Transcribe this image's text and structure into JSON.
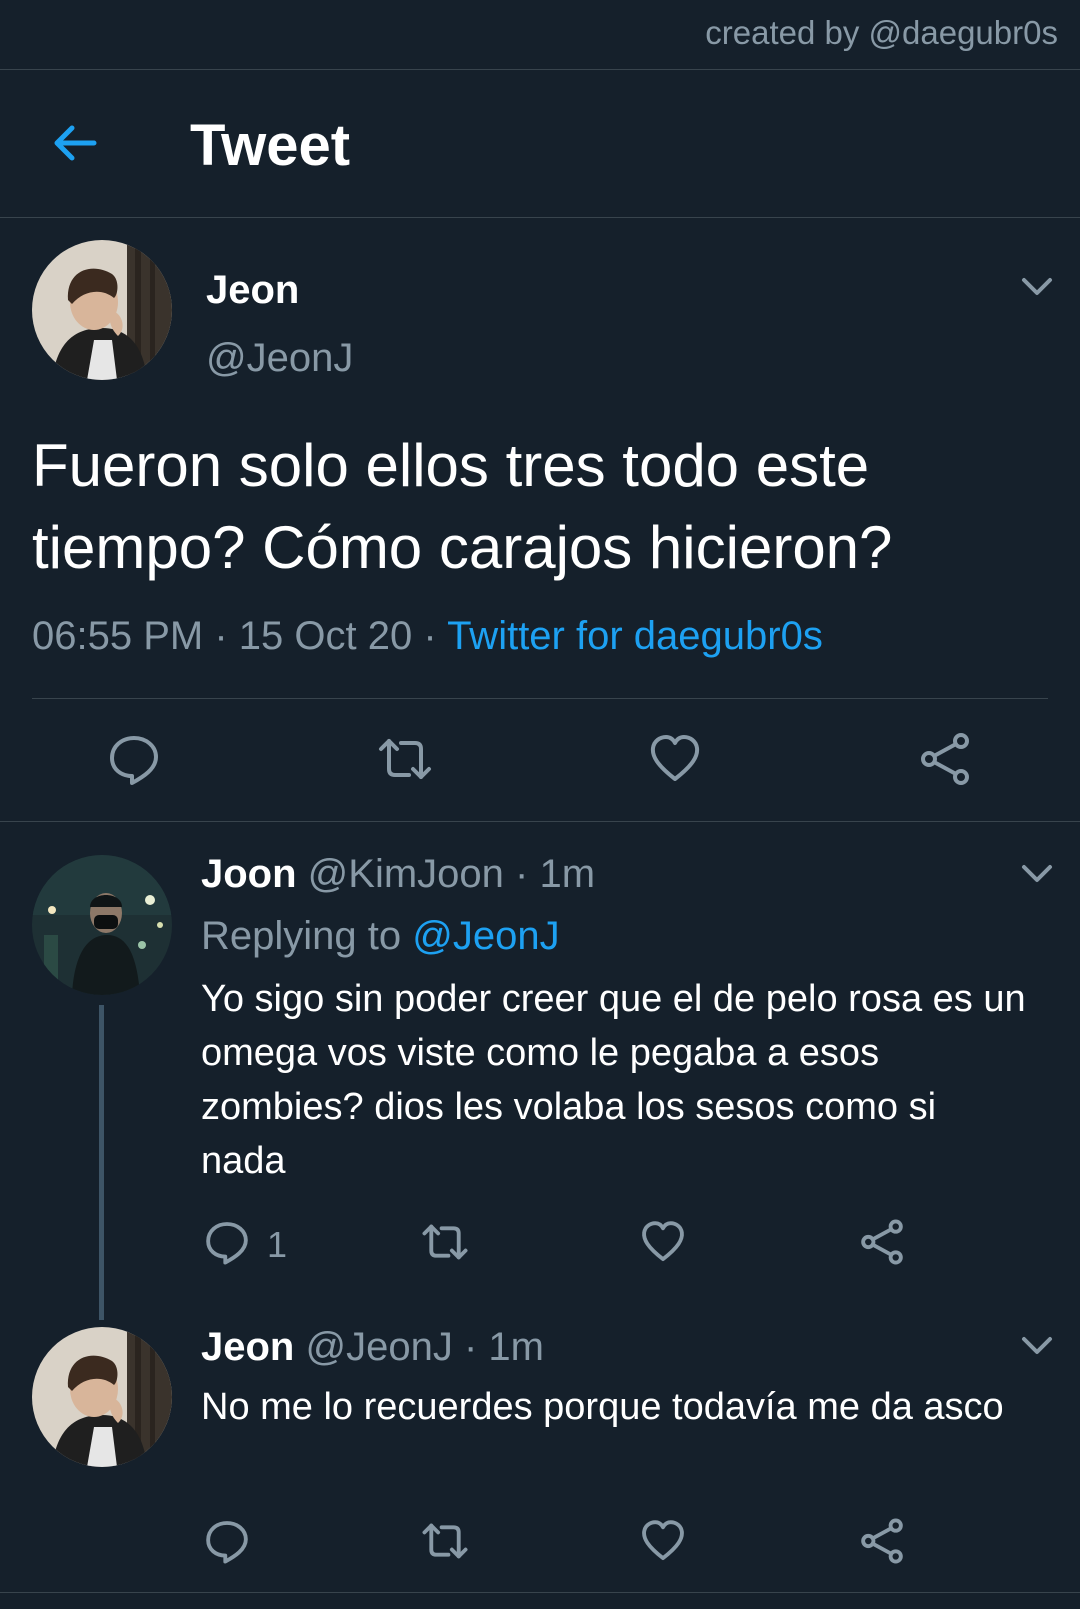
{
  "credit": "created by @daegubr0s",
  "header": {
    "title": "Tweet"
  },
  "main_tweet": {
    "name": "Jeon",
    "handle": "@JeonJ",
    "text": "Fueron solo ellos tres todo este tiempo? Cómo carajos hicieron?",
    "time": "06:55 PM",
    "sep1": "·",
    "date": "15 Oct 20",
    "sep2": "·",
    "source": "Twitter for daegubr0s"
  },
  "replies": [
    {
      "name": "Joon",
      "handle": "@KimJoon",
      "sep": "·",
      "time": "1m",
      "replying_prefix": "Replying to",
      "replying_to": "@JeonJ",
      "text": "Yo sigo sin poder creer que el de pelo rosa es un omega vos viste como le pegaba a esos zombies? dios les volaba los sesos como si nada",
      "reply_count": "1"
    },
    {
      "name": "Jeon",
      "handle": "@JeonJ",
      "sep": "·",
      "time": "1m",
      "text": "No me lo recuerdes porque todavía me da asco"
    }
  ],
  "icons": {
    "back": "arrow-left-icon",
    "more": "chevron-down-icon",
    "reply": "comment-icon",
    "retweet": "retweet-icon",
    "like": "heart-icon",
    "share": "share-icon"
  },
  "colors": {
    "background": "#15202b",
    "accent": "#1da1f2",
    "muted": "#8899a6",
    "divider": "#38444d"
  }
}
